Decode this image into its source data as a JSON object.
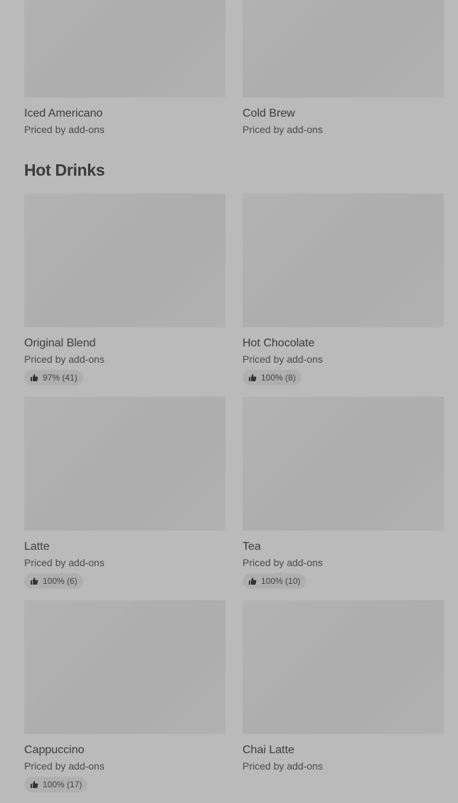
{
  "top_items": [
    {
      "name": "Iced Americano",
      "price": "Priced by add-ons"
    },
    {
      "name": "Cold Brew",
      "price": "Priced by add-ons"
    }
  ],
  "hot_drinks": {
    "heading": "Hot Drinks",
    "items": [
      {
        "name": "Original Blend",
        "price": "Priced by add-ons",
        "rating": "97% (41)"
      },
      {
        "name": "Hot Chocolate",
        "price": "Priced by add-ons",
        "rating": "100% (8)"
      },
      {
        "name": "Latte",
        "price": "Priced by add-ons",
        "rating": "100% (6)"
      },
      {
        "name": "Tea",
        "price": "Priced by add-ons",
        "rating": "100% (10)"
      },
      {
        "name": "Cappuccino",
        "price": "Priced by add-ons",
        "rating": "100% (17)"
      },
      {
        "name": "Chai Latte",
        "price": "Priced by add-ons"
      }
    ]
  },
  "icons": {
    "rating": "thumbs-up-icon"
  },
  "colors": {
    "overlay_background": "#bababa",
    "image_placeholder": "#b0b0b0",
    "badge_background": "#afafaf",
    "text_primary": "#3a3a3a"
  }
}
